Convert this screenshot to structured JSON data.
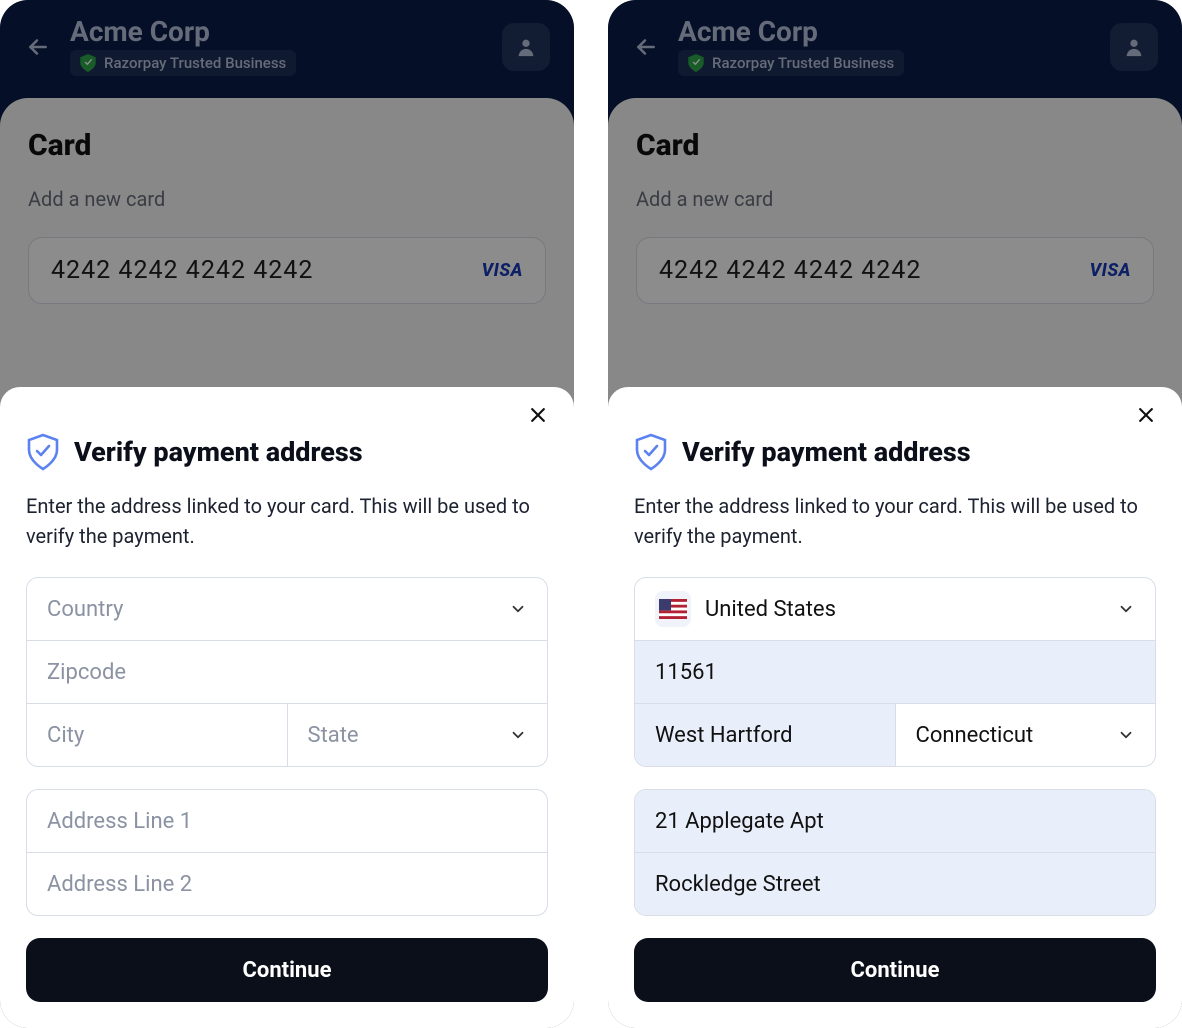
{
  "header": {
    "merchant_name": "Acme Corp",
    "trusted_text": "Razorpay Trusted Business"
  },
  "card_panel": {
    "title": "Card",
    "subtitle": "Add a new card",
    "card_number": "4242 4242 4242 4242",
    "brand": "VISA"
  },
  "sheet": {
    "title": "Verify payment address",
    "subtitle": "Enter the address linked to your card. This will be used to verify the payment.",
    "continue_label": "Continue"
  },
  "left": {
    "country_placeholder": "Country",
    "zipcode_placeholder": "Zipcode",
    "city_placeholder": "City",
    "state_placeholder": "State",
    "addr1_placeholder": "Address Line 1",
    "addr2_placeholder": "Address Line 2"
  },
  "right": {
    "country_value": "United States",
    "zipcode_value": "11561",
    "city_value": "West Hartford",
    "state_value": "Connecticut",
    "addr1_value": "21 Applegate Apt",
    "addr2_value": "Rockledge Street"
  }
}
